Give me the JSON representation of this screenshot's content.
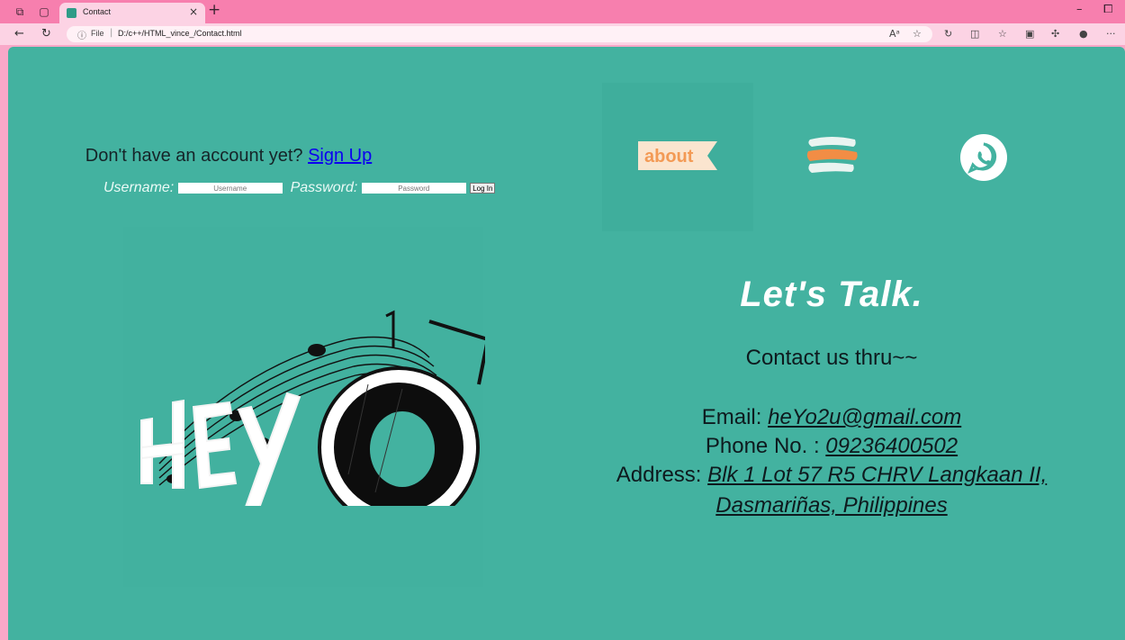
{
  "browser": {
    "tab_title": "Contact",
    "url_label": "File",
    "url": "D:/c++/HTML_vince_/Contact.html"
  },
  "account": {
    "prompt": "Don't have an account yet?",
    "signup_label": "Sign Up",
    "username_label": "Username:",
    "username_placeholder": "Username",
    "password_label": "Password:",
    "password_placeholder": "Password",
    "login_label": "Log In"
  },
  "nav": {
    "about_label": "about",
    "about_color": "#f39a55",
    "menu_icon": "menu-brush-icon",
    "whatsapp_icon": "whatsapp-icon"
  },
  "logo": {
    "text": "HEYO"
  },
  "contact": {
    "heading": "Let's Talk.",
    "intro": "Contact us thru~~",
    "email_label": "Email:",
    "email": "heYo2u@gmail.com",
    "phone_label": "Phone No. :",
    "phone": "09236400502",
    "address_label": "Address:",
    "address_line1": "Blk 1 Lot 57 R5 CHRV Langkaan II,",
    "address_line2": "Dasmariñas, Philippines"
  },
  "colors": {
    "page_bg": "#43b2a0",
    "chrome": "#f77fae",
    "link": "#0b00f0"
  }
}
